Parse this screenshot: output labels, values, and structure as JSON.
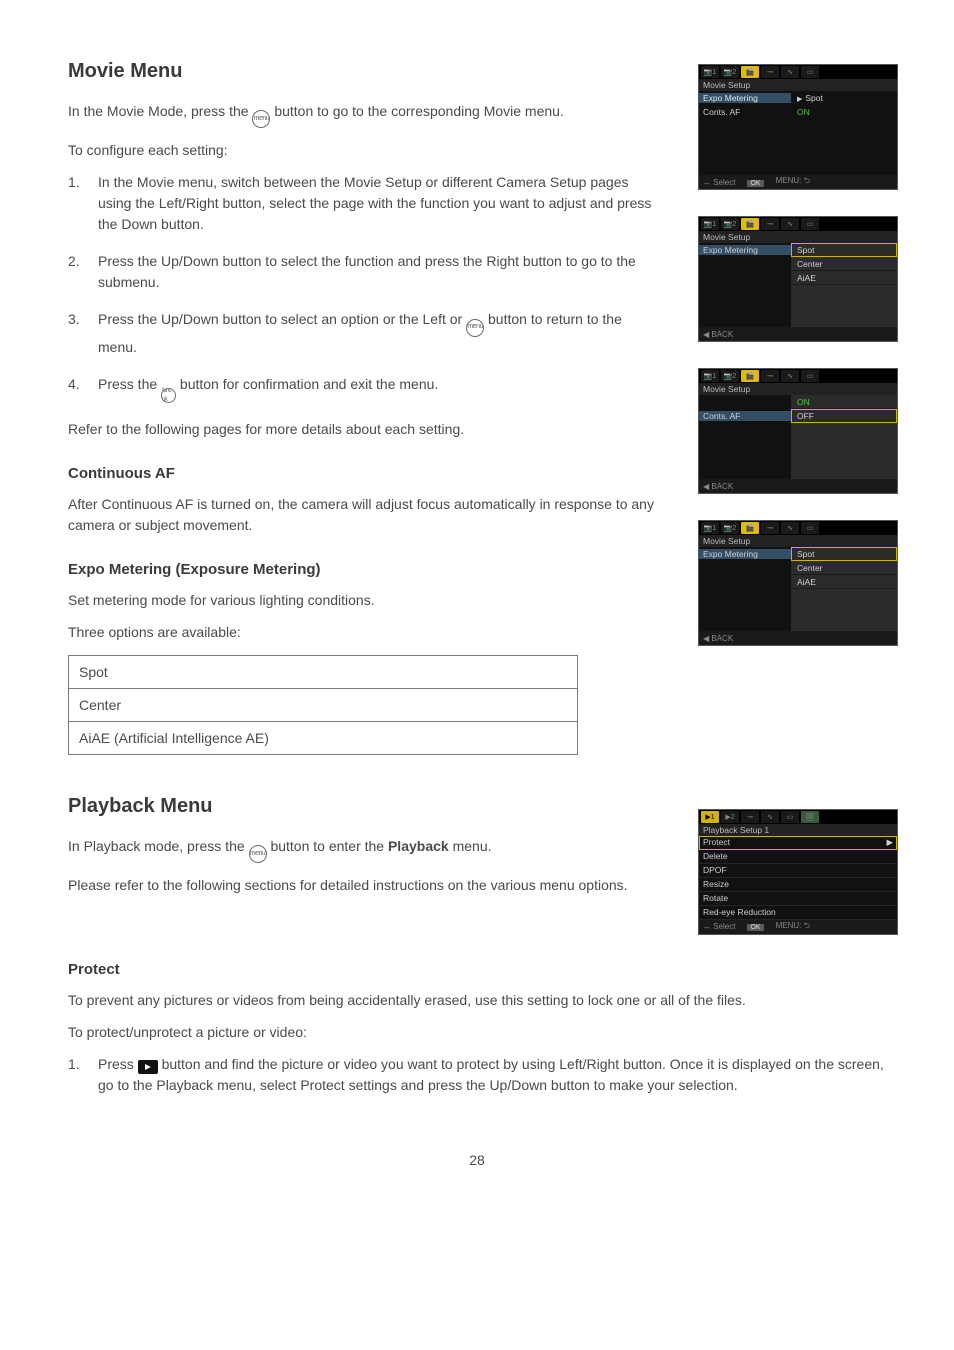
{
  "page_number": "28",
  "movie": {
    "heading": "Movie Menu",
    "intro_a": "In the Movie Mode, press the ",
    "intro_b": " button to go to the corresponding Movie menu.",
    "config": "To configure each setting:",
    "steps": {
      "s1_num": "1.",
      "s1": "In the Movie menu, switch between the Movie Setup or different Camera Setup pages using the Left/Right button, select the page with the function you want to adjust and press the Down button.",
      "s2_num": "2.",
      "s2": "Press the Up/Down button to select the function and press the Right button to go to the submenu.",
      "s3_num": "3.",
      "s3_a": "Press the Up/Down button to select an option or the Left or ",
      "s3_b": " button to return to the menu.",
      "s4_num": "4.",
      "s4_a": "Press the ",
      "s4_b": " button for confirmation and exit the menu.",
      "icon_menu": "menu",
      "icon_func": "func ok"
    },
    "refer": "Refer to the following pages for more details about each setting.",
    "caf_h": "Continuous AF",
    "caf_p": "After Continuous AF is turned on, the camera will adjust focus automatically in response to any camera or subject movement.",
    "expo_h": "Expo Metering (Exposure Metering)",
    "expo_p": "Set metering mode for various lighting conditions.",
    "expo_three": "Three options are available:",
    "opts": {
      "spot": "Spot",
      "center": "Center",
      "aiae": "AiAE (Artificial Intelligence AE)"
    }
  },
  "thumbs": {
    "t1": {
      "title": "Movie Setup",
      "row1_l": "Expo Metering",
      "row1_r": "Spot",
      "row2_l": "Conts. AF",
      "row2_r": "ON",
      "foot_select": "Select",
      "foot_ok": "OK",
      "foot_menu": "MENU:"
    },
    "t2": {
      "title": "Movie Setup",
      "row1_l": "Expo Metering",
      "opts": [
        "Spot",
        "Center",
        "AiAE"
      ],
      "back": "BACK"
    },
    "t3": {
      "title": "Movie Setup",
      "row1_l": "Conts. AF",
      "opts": [
        "ON",
        "OFF"
      ],
      "back": "BACK"
    },
    "t4": {
      "title": "Movie Setup",
      "row1_l": "Expo Metering",
      "opts": [
        "Spot",
        "Center",
        "AiAE"
      ],
      "back": "BACK"
    },
    "tp": {
      "title": "Playback Setup 1",
      "rows": [
        "Protect",
        "Delete",
        "DPOF",
        "Resize",
        "Rotate",
        "Red-eye Reduction"
      ],
      "foot_select": "Select",
      "foot_ok": "OK",
      "foot_menu": "MENU:"
    }
  },
  "playback": {
    "heading": "Playback Menu",
    "intro_a": "In Playback mode, press the ",
    "intro_b": " button to enter the ",
    "intro_bold": "Playback",
    "intro_c": " menu.",
    "refer": "Please refer to the following sections for detailed instructions on the various menu options.",
    "protect_h": "Protect",
    "protect_p": "To prevent any pictures or videos from being accidentally erased, use this setting to lock one or all of the files.",
    "protect_do": "To protect/unprotect a picture or video:",
    "s1_num": "1.",
    "s1_a": "Press ",
    "s1_b": " button and find the picture or video you want to protect by using Left/Right button.  Once it is displayed on the screen, go to the Playback menu, select Protect settings and press the Up/Down button to make your selection."
  }
}
